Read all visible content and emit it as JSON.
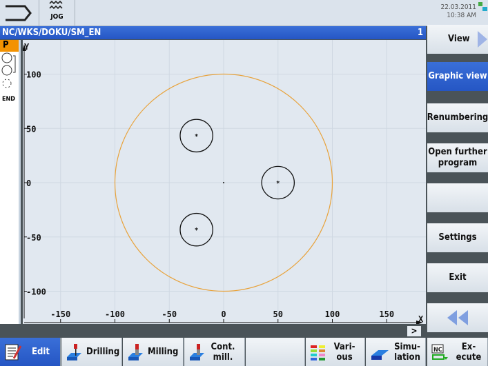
{
  "header": {
    "mode": "JOG",
    "date": "22.03.2011",
    "time": "10:38 AM"
  },
  "path": {
    "program": "NC/WKS/DOKU/SM_EN",
    "channel": "1"
  },
  "left_panel": {
    "items": [
      "P",
      "END"
    ]
  },
  "plot": {
    "x_axis_label": "X",
    "y_axis_label": "Y",
    "x_ticks": [
      "-150",
      "-100",
      "-50",
      "0",
      "50",
      "100",
      "150"
    ],
    "y_ticks": [
      "100",
      "50",
      "0",
      "-50",
      "-100"
    ],
    "outer_circle": {
      "center": [
        0,
        0
      ],
      "radius": 100,
      "color": "#e8a23a"
    },
    "holes": [
      {
        "center": [
          50,
          0
        ],
        "radius": 15
      },
      {
        "center": [
          -25,
          43.3
        ],
        "radius": 15
      },
      {
        "center": [
          -25,
          -43.3
        ],
        "radius": 15
      }
    ]
  },
  "softkeys": {
    "view": "View",
    "graphic_view": "Graphic view",
    "renumbering": "Renumbering",
    "open_further": "Open further program",
    "settings": "Settings",
    "exit": "Exit"
  },
  "bottom": {
    "edit": "Edit",
    "drilling": "Drilling",
    "milling": "Milling",
    "cont_mill": "Cont. mill.",
    "various": "Vari- ous",
    "simulation": "Simu- lation",
    "execute": "Ex- ecute",
    "more": ">"
  },
  "colors": {
    "accent": "#2556c4",
    "contour": "#e8a23a"
  }
}
